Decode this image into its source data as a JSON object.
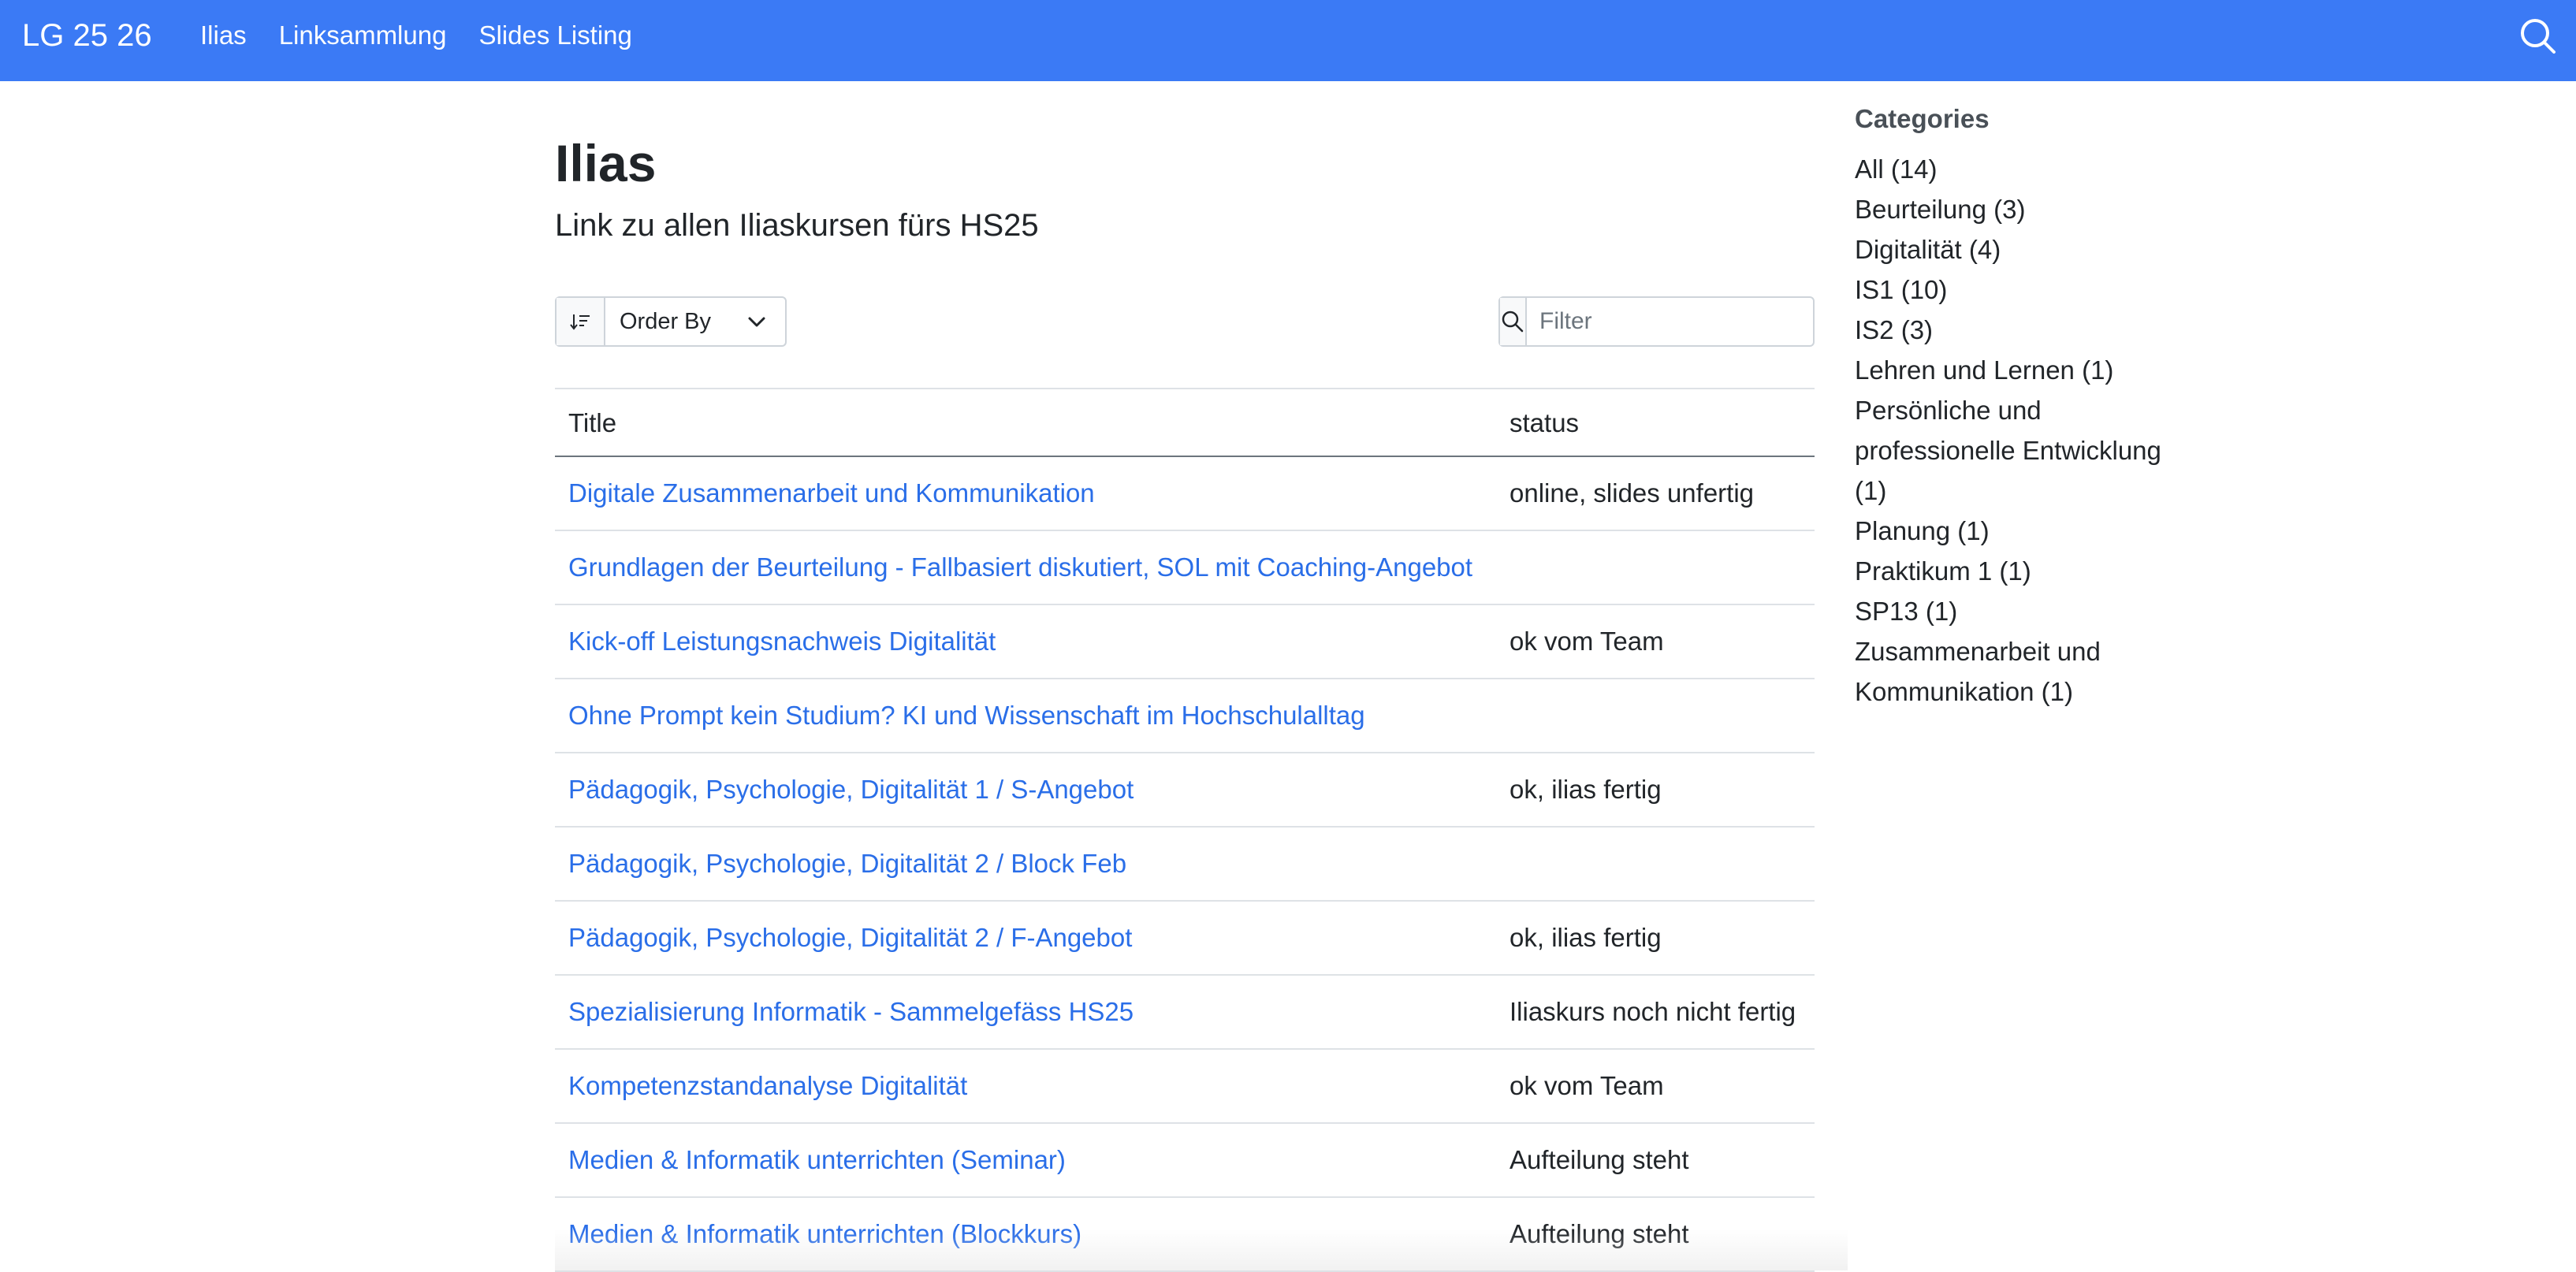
{
  "navbar": {
    "brand": "LG 25 26",
    "links": [
      "Ilias",
      "Linksammlung",
      "Slides Listing"
    ],
    "search_icon": "search-icon",
    "color": "#3b7af5"
  },
  "page": {
    "title": "Ilias",
    "subtitle": "Link zu allen Iliaskursen fürs HS25"
  },
  "controls": {
    "order_by_label": "Order By",
    "filter_placeholder": "Filter"
  },
  "table": {
    "headers": [
      "Title",
      "status"
    ],
    "rows": [
      {
        "title": "Digitale Zusammenarbeit und Kommunikation",
        "status": "online, slides unfertig"
      },
      {
        "title": "Grundlagen der Beurteilung - Fallbasiert diskutiert, SOL mit Coaching-Angebot",
        "status": ""
      },
      {
        "title": "Kick-off Leistungsnachweis Digitalität",
        "status": "ok vom Team"
      },
      {
        "title": "Ohne Prompt kein Studium? KI und Wissenschaft im Hochschulalltag",
        "status": ""
      },
      {
        "title": "Pädagogik, Psychologie, Digitalität 1 / S-Angebot",
        "status": "ok, ilias fertig"
      },
      {
        "title": "Pädagogik, Psychologie, Digitalität 2 / Block Feb",
        "status": ""
      },
      {
        "title": "Pädagogik, Psychologie, Digitalität 2 / F-Angebot",
        "status": "ok, ilias fertig"
      },
      {
        "title": "Spezialisierung Informatik - Sammelgefäss HS25",
        "status": "Iliaskurs noch nicht fertig"
      },
      {
        "title": "Kompetenzstandanalyse Digitalität",
        "status": "ok vom Team"
      },
      {
        "title": "Medien & Informatik unterrichten (Seminar)",
        "status": "Aufteilung steht"
      },
      {
        "title": "Medien & Informatik unterrichten (Blockkurs)",
        "status": "Aufteilung steht"
      }
    ]
  },
  "sidebar": {
    "heading": "Categories",
    "categories": [
      "All (14)",
      "Beurteilung (3)",
      "Digitalität (4)",
      "IS1 (10)",
      "IS2 (3)",
      "Lehren und Lernen (1)",
      "Persönliche und professionelle Entwicklung (1)",
      "Planung (1)",
      "Praktikum 1 (1)",
      "SP13 (1)",
      "Zusammenarbeit und Kommunikation (1)"
    ]
  }
}
